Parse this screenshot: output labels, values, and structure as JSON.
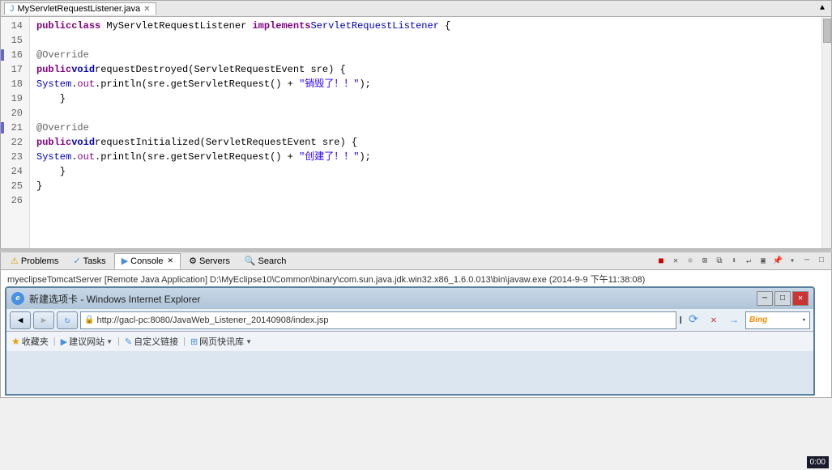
{
  "editor": {
    "tab_label": "MyServletRequestListener.java",
    "code_lines": [
      {
        "num": "14",
        "has_marker": false,
        "content": "public class MyServletRequestListener implements ServletRequestListener {"
      },
      {
        "num": "15",
        "has_marker": false,
        "content": ""
      },
      {
        "num": "16",
        "has_marker": true,
        "content": "    @Override"
      },
      {
        "num": "17",
        "has_marker": false,
        "content": "    public void requestDestroyed(ServletRequestEvent sre) {"
      },
      {
        "num": "18",
        "has_marker": false,
        "content": "        System.out.println(sre.getServletRequest() + \"销毁了！！\");"
      },
      {
        "num": "19",
        "has_marker": false,
        "content": "    }"
      },
      {
        "num": "20",
        "has_marker": false,
        "content": ""
      },
      {
        "num": "21",
        "has_marker": true,
        "content": "    @Override"
      },
      {
        "num": "22",
        "has_marker": false,
        "content": "    public void requestInitialized(ServletRequestEvent sre) {"
      },
      {
        "num": "23",
        "has_marker": false,
        "content": "        System.out.println(sre.getServletRequest() + \"创建了！！\");"
      },
      {
        "num": "24",
        "has_marker": false,
        "content": "    }"
      },
      {
        "num": "25",
        "has_marker": false,
        "content": "}"
      },
      {
        "num": "26",
        "has_marker": false,
        "content": ""
      }
    ]
  },
  "panel": {
    "tabs": [
      {
        "label": "Problems",
        "icon": "⚠",
        "active": false
      },
      {
        "label": "Tasks",
        "icon": "✓",
        "active": false
      },
      {
        "label": "Console",
        "icon": "▶",
        "active": true
      },
      {
        "label": "Servers",
        "icon": "⚙",
        "active": false
      },
      {
        "label": "Search",
        "icon": "🔍",
        "active": false
      }
    ],
    "console_text": "myeclipseTomcatServer [Remote Java Application] D:\\MyEclipse10\\Common\\binary\\com.sun.java.jdk.win32.x86_1.6.0.013\\bin\\javaw.exe (2014-9-9 下午11:38:08)"
  },
  "browser": {
    "title": "新建选项卡 - Windows Internet Explorer",
    "url": "http://gacl-pc:8080/JavaWeb_Listener_20140908/index.jsp",
    "search_placeholder": "Bing",
    "fav_items": [
      "收藏夹",
      "建议网站",
      "自定义链接",
      "网页快讯库"
    ]
  },
  "taskbar": {
    "time": "0:00"
  }
}
